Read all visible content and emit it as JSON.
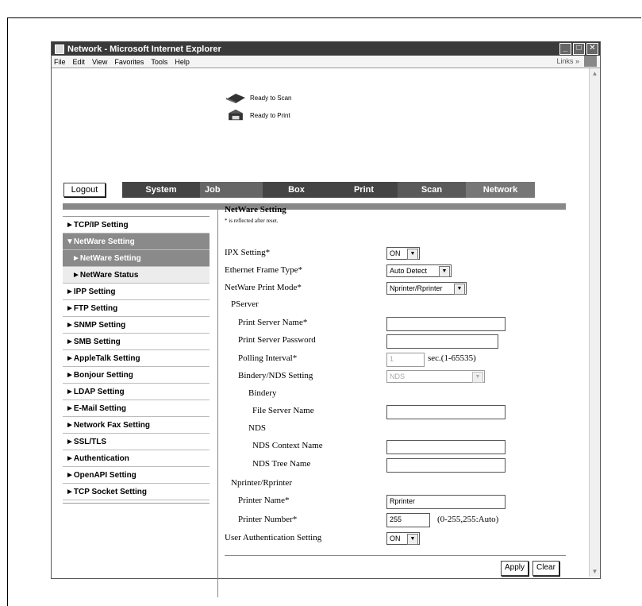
{
  "window": {
    "title": "Network - Microsoft Internet Explorer"
  },
  "menu": [
    "File",
    "Edit",
    "View",
    "Favorites",
    "Tools",
    "Help"
  ],
  "links_label": "Links »",
  "status": {
    "scan": "Ready to Scan",
    "print": "Ready to Print"
  },
  "logout_label": "Logout",
  "tabs": [
    "System",
    "Job",
    "Box",
    "Print",
    "Scan",
    "Network"
  ],
  "sidebar": [
    "►TCP/IP Setting",
    "▼NetWare Setting",
    "►NetWare Setting",
    "►NetWare Status",
    "►IPP Setting",
    "►FTP Setting",
    "►SNMP Setting",
    "►SMB Setting",
    "►AppleTalk Setting",
    "►Bonjour Setting",
    "►LDAP Setting",
    "►E-Mail Setting",
    "►Network Fax Setting",
    "►SSL/TLS",
    "►Authentication",
    "►OpenAPI Setting",
    "►TCP Socket Setting"
  ],
  "form": {
    "title": "NetWare Setting",
    "note": "* is reflected after reset.",
    "ipx_label": "IPX Setting*",
    "ipx_value": "ON",
    "frame_label": "Ethernet Frame Type*",
    "frame_value": "Auto Detect",
    "mode_label": "NetWare Print Mode*",
    "mode_value": "Nprinter/Rprinter",
    "pserver_label": "PServer",
    "psname_label": "Print Server Name*",
    "pspass_label": "Print Server Password",
    "poll_label": "Polling Interval*",
    "poll_value": "1",
    "poll_hint": "sec.(1-65535)",
    "bindery_nds_label": "Bindery/NDS Setting",
    "bindery_nds_value": "NDS",
    "bindery_label": "Bindery",
    "fileserver_label": "File Server Name",
    "nds_label": "NDS",
    "nds_context_label": "NDS Context Name",
    "nds_tree_label": "NDS Tree Name",
    "nprinter_label": "Nprinter/Rprinter",
    "printer_name_label": "Printer Name*",
    "printer_name_value": "Rprinter",
    "printer_number_label": "Printer Number*",
    "printer_number_value": "255",
    "printer_number_hint": "(0-255,255:Auto)",
    "userauth_label": "User Authentication Setting",
    "userauth_value": "ON",
    "apply_label": "Apply",
    "clear_label": "Clear"
  }
}
